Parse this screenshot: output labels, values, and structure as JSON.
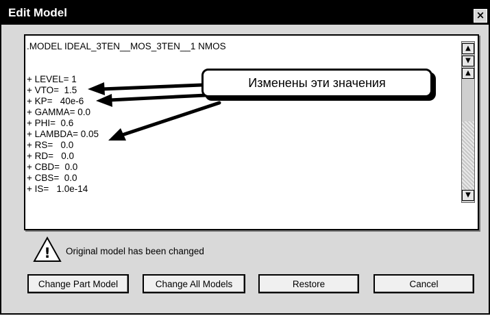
{
  "window": {
    "title": "Edit Model",
    "close_glyph": "×"
  },
  "editor": {
    "lines": [
      ".MODEL IDEAL_3TEN__MOS_3TEN__1 NMOS",
      "",
      "",
      "+ LEVEL= 1",
      "+ VTO=  1.5",
      "+ KP=   40e-6",
      "+ GAMMA= 0.0",
      "+ PHI=  0.6",
      "+ LAMBDA= 0.05",
      "+ RS=   0.0",
      "+ RD=   0.0",
      "+ CBD=  0.0",
      "+ CBS=  0.0",
      "+ IS=   1.0e-14"
    ]
  },
  "annotation": {
    "callout_text": "Изменены эти значения"
  },
  "warning": {
    "icon": "warning-icon",
    "glyph": "!",
    "text": "Original model has been changed"
  },
  "buttons": {
    "change_part": "Change Part Model",
    "change_all": "Change All Models",
    "restore": "Restore",
    "cancel": "Cancel"
  },
  "colors": {
    "titlebar": "#000000",
    "dialog": "#d9d9d9",
    "editor": "#ffffff"
  }
}
